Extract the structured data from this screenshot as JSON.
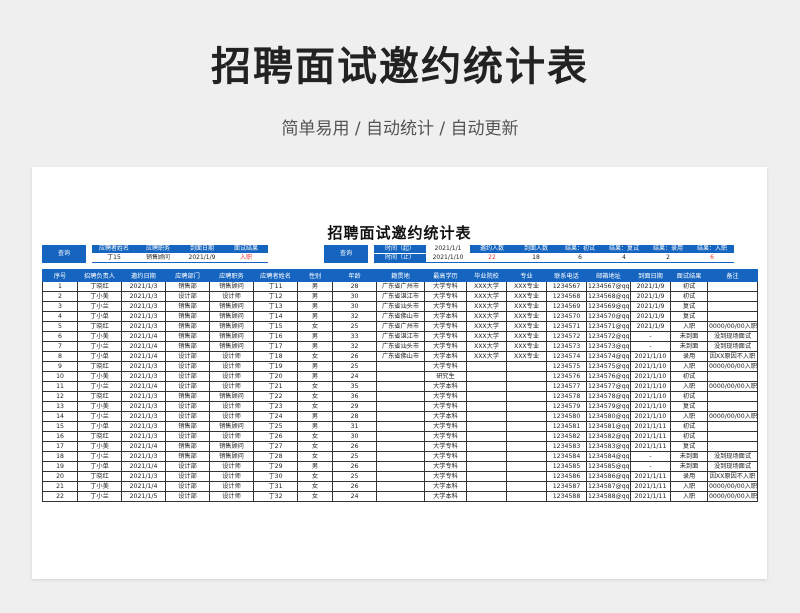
{
  "hero": {
    "title": "招聘面试邀约统计表",
    "subtitle": "简单易用 / 自动统计 / 自动更新"
  },
  "sheet_title": "招聘面试邀约统计表",
  "query1": {
    "button": "查询",
    "labels": [
      "应聘者姓名",
      "应聘职务",
      "到面日期",
      "面试结果"
    ],
    "values": [
      "丁15",
      "销售顾问",
      "2021/1/9",
      "入职"
    ]
  },
  "query2": {
    "button": "查询",
    "time_start_label": "时间（起）",
    "time_start": "2021/1/1",
    "time_end_label": "时间（止）",
    "time_end": "2021/1/10",
    "stat_labels": [
      "邀约人数",
      "到面人数",
      "结果：初试",
      "结果：复试",
      "结果：录用",
      "结果：入职"
    ],
    "stat_values": [
      "22",
      "18",
      "6",
      "4",
      "2",
      "6"
    ]
  },
  "table": {
    "headers": [
      "序号",
      "招聘负责人",
      "邀约日期",
      "应聘部门",
      "应聘职务",
      "应聘者姓名",
      "性别",
      "年龄",
      "籍贯地",
      "最高学历",
      "毕业院校",
      "专业",
      "联系电话",
      "邮箱地址",
      "到面日期",
      "面试结果",
      "备注"
    ],
    "rows": [
      [
        "1",
        "丁晓红",
        "2021/1/3",
        "销售部",
        "销售顾问",
        "丁11",
        "男",
        "28",
        "广东省广州市",
        "大学专科",
        "XXX大学",
        "XXX专业",
        "1234567",
        "1234567@qq.com",
        "2021/1/9",
        "初试",
        ""
      ],
      [
        "2",
        "丁小美",
        "2021/1/3",
        "设计部",
        "设计师",
        "丁12",
        "男",
        "30",
        "广东省湛江市",
        "大学专科",
        "XXX大学",
        "XXX专业",
        "1234568",
        "1234568@qq.com",
        "2021/1/9",
        "初试",
        ""
      ],
      [
        "3",
        "丁小兰",
        "2021/1/3",
        "销售部",
        "销售顾问",
        "丁13",
        "男",
        "30",
        "广东省汕头市",
        "大学专科",
        "XXX大学",
        "XXX专业",
        "1234569",
        "1234569@qq.com",
        "2021/1/9",
        "复试",
        ""
      ],
      [
        "4",
        "丁小单",
        "2021/1/3",
        "销售部",
        "销售顾问",
        "丁14",
        "男",
        "32",
        "广东省佛山市",
        "大学本科",
        "XXX大学",
        "XXX专业",
        "1234570",
        "1234570@qq.com",
        "2021/1/9",
        "复试",
        ""
      ],
      [
        "5",
        "丁晓红",
        "2021/1/3",
        "销售部",
        "销售顾问",
        "丁15",
        "女",
        "25",
        "广东省广州市",
        "大学专科",
        "XXX大学",
        "XXX专业",
        "1234571",
        "1234571@qq.com",
        "2021/1/9",
        "入职",
        "0000/00/00入职"
      ],
      [
        "6",
        "丁小美",
        "2021/1/4",
        "销售部",
        "销售顾问",
        "丁16",
        "男",
        "33",
        "广东省湛江市",
        "大学专科",
        "XXX大学",
        "XXX专业",
        "1234572",
        "1234572@qq.com",
        "-",
        "未到面",
        "没到现场面试"
      ],
      [
        "7",
        "丁小兰",
        "2021/1/4",
        "销售部",
        "销售顾问",
        "丁17",
        "男",
        "32",
        "广东省汕头市",
        "大学专科",
        "XXX大学",
        "XXX专业",
        "1234573",
        "1234573@qq.com",
        "-",
        "未到面",
        "没到现场面试"
      ],
      [
        "8",
        "丁小单",
        "2021/1/4",
        "设计部",
        "设计师",
        "丁18",
        "女",
        "26",
        "广东省佛山市",
        "大学本科",
        "XXX大学",
        "XXX专业",
        "1234574",
        "1234574@qq.com",
        "2021/1/10",
        "录用",
        "因XX原因不入职"
      ],
      [
        "9",
        "丁晓红",
        "2021/1/3",
        "设计部",
        "设计师",
        "丁19",
        "男",
        "25",
        "",
        "大学专科",
        "",
        "",
        "1234575",
        "1234575@qq.com",
        "2021/1/10",
        "入职",
        "0000/00/00入职"
      ],
      [
        "10",
        "丁小美",
        "2021/1/3",
        "设计部",
        "设计师",
        "丁20",
        "男",
        "24",
        "",
        "研究生",
        "",
        "",
        "1234576",
        "1234576@qq.com",
        "2021/1/10",
        "初试",
        ""
      ],
      [
        "11",
        "丁小兰",
        "2021/1/4",
        "设计部",
        "设计师",
        "丁21",
        "女",
        "35",
        "",
        "大学本科",
        "",
        "",
        "1234577",
        "1234577@qq.com",
        "2021/1/10",
        "入职",
        "0000/00/00入职"
      ],
      [
        "12",
        "丁晓红",
        "2021/1/3",
        "销售部",
        "销售顾问",
        "丁22",
        "女",
        "36",
        "",
        "大学专科",
        "",
        "",
        "1234578",
        "1234578@qq.com",
        "2021/1/10",
        "初试",
        ""
      ],
      [
        "13",
        "丁小美",
        "2021/1/3",
        "设计部",
        "设计师",
        "丁23",
        "女",
        "29",
        "",
        "大学专科",
        "",
        "",
        "1234579",
        "1234579@qq.com",
        "2021/1/10",
        "复试",
        ""
      ],
      [
        "14",
        "丁小兰",
        "2021/1/3",
        "设计部",
        "设计师",
        "丁24",
        "男",
        "28",
        "",
        "大学本科",
        "",
        "",
        "1234580",
        "1234580@qq.com",
        "2021/1/10",
        "入职",
        "0000/00/00入职"
      ],
      [
        "15",
        "丁小单",
        "2021/1/3",
        "销售部",
        "销售顾问",
        "丁25",
        "男",
        "31",
        "",
        "大学专科",
        "",
        "",
        "1234581",
        "1234581@qq.com",
        "2021/1/11",
        "初试",
        ""
      ],
      [
        "16",
        "丁晓红",
        "2021/1/3",
        "设计部",
        "设计师",
        "丁26",
        "女",
        "30",
        "",
        "大学专科",
        "",
        "",
        "1234582",
        "1234582@qq.com",
        "2021/1/11",
        "初试",
        ""
      ],
      [
        "17",
        "丁小美",
        "2021/1/4",
        "销售部",
        "销售顾问",
        "丁27",
        "女",
        "26",
        "",
        "大学专科",
        "",
        "",
        "1234583",
        "1234583@qq.com",
        "2021/1/11",
        "复试",
        ""
      ],
      [
        "18",
        "丁小兰",
        "2021/1/3",
        "销售部",
        "销售顾问",
        "丁28",
        "女",
        "25",
        "",
        "大学专科",
        "",
        "",
        "1234584",
        "1234584@qq.com",
        "-",
        "未到面",
        "没到现场面试"
      ],
      [
        "19",
        "丁小单",
        "2021/1/4",
        "设计部",
        "设计师",
        "丁29",
        "男",
        "26",
        "",
        "大学专科",
        "",
        "",
        "1234585",
        "1234585@qq.com",
        "-",
        "未到面",
        "没到现场面试"
      ],
      [
        "20",
        "丁晓红",
        "2021/1/3",
        "设计部",
        "设计师",
        "丁30",
        "女",
        "25",
        "",
        "大学专科",
        "",
        "",
        "1234586",
        "1234586@qq.com",
        "2021/1/11",
        "录用",
        "因XX原因不入职"
      ],
      [
        "21",
        "丁小美",
        "2021/1/4",
        "设计部",
        "设计师",
        "丁31",
        "女",
        "26",
        "",
        "大学本科",
        "",
        "",
        "1234587",
        "1234587@qq.com",
        "2021/1/11",
        "入职",
        "0000/00/00入职"
      ],
      [
        "22",
        "丁小兰",
        "2021/1/5",
        "设计部",
        "设计师",
        "丁32",
        "女",
        "24",
        "",
        "大学本科",
        "",
        "",
        "1234588",
        "1234588@qq.com",
        "2021/1/11",
        "入职",
        "0000/00/00入职"
      ]
    ]
  }
}
